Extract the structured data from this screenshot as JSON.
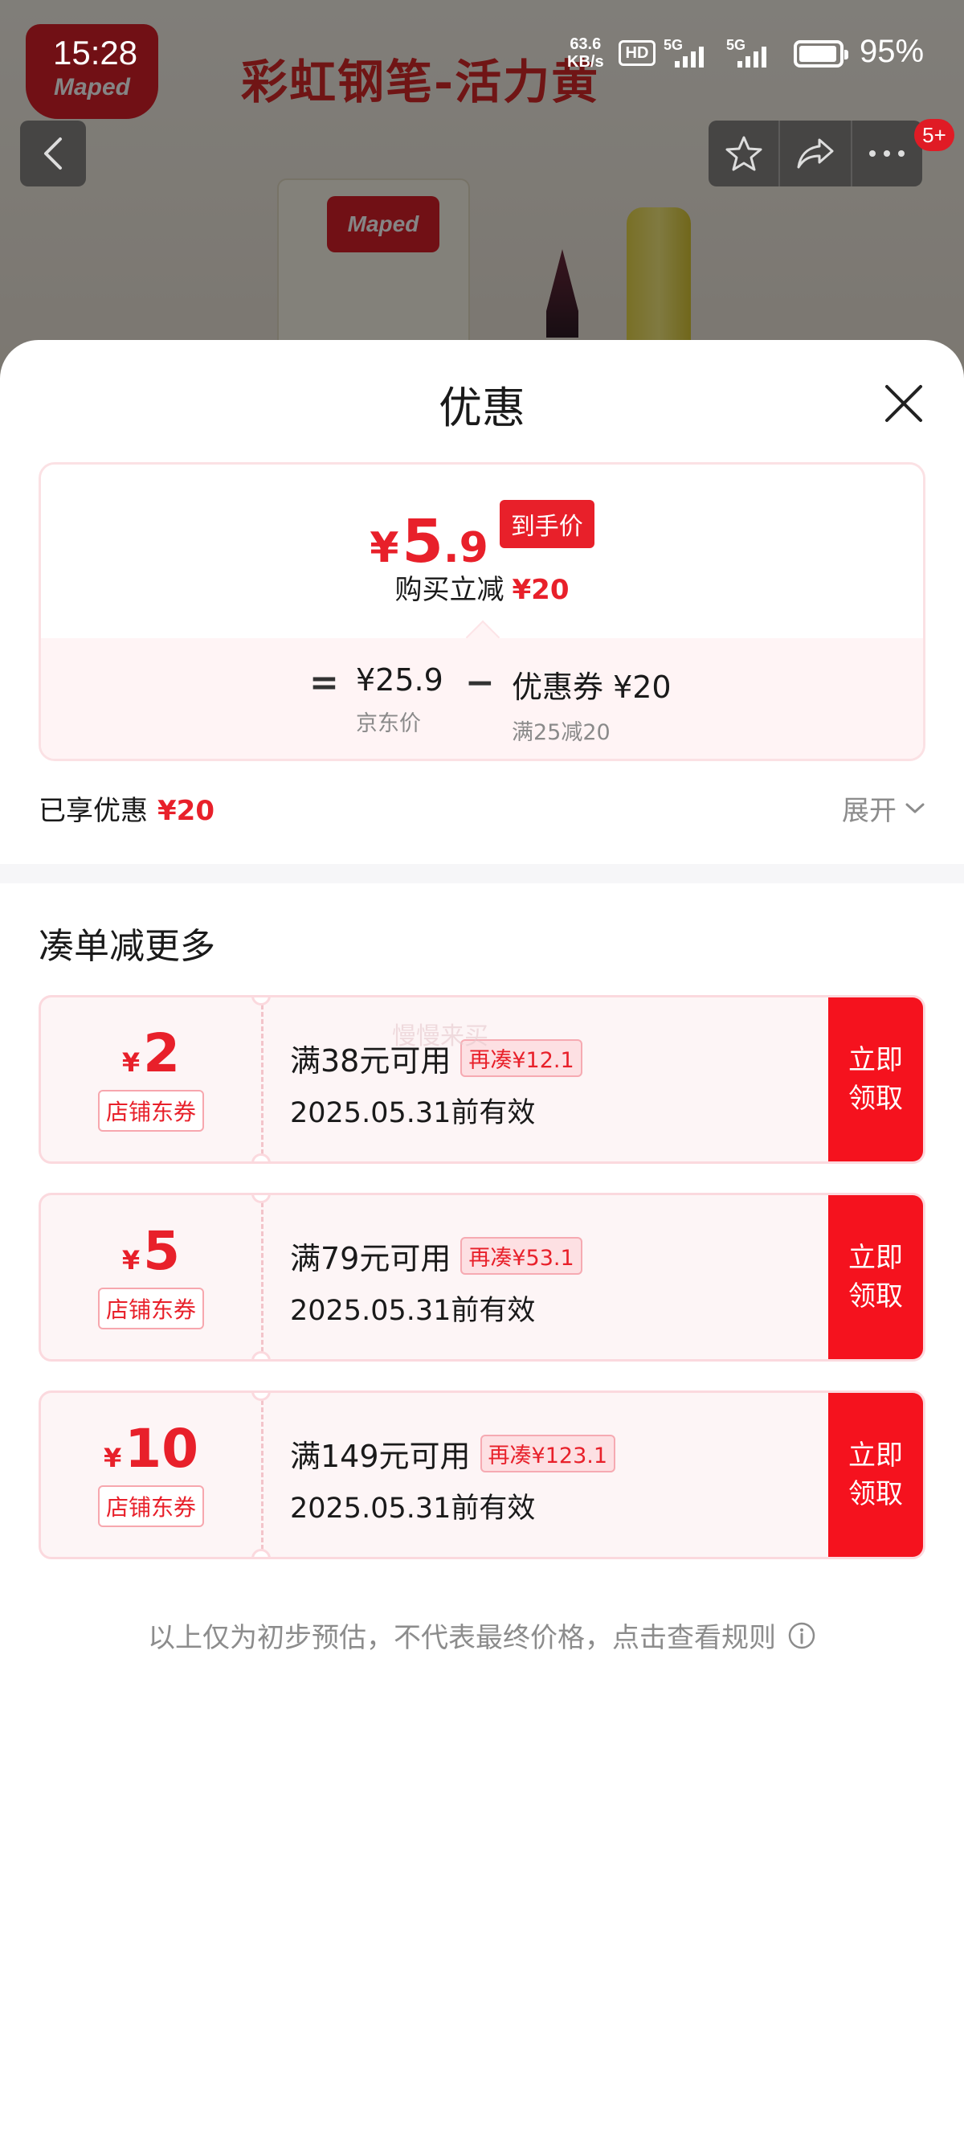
{
  "status_bar": {
    "time": "15:28",
    "net_speed_value": "63.6",
    "net_speed_unit": "KB/s",
    "hd_label": "HD",
    "signal_1_label": "5G",
    "signal_2_label": "5G",
    "battery_percent": "95%"
  },
  "background_page": {
    "brand_logo": "Maped",
    "title": "彩虹钢笔-活力黄",
    "box_logo": "Maped",
    "cart_badge": "5+"
  },
  "sheet": {
    "title": "优惠",
    "price_card": {
      "final_currency": "¥",
      "final_int": "5",
      "final_dec": ".9",
      "final_tag": "到手价",
      "reduce_label": "购买立减",
      "reduce_amount": "¥20",
      "eq_sign": "=",
      "minus_sign": "−",
      "jd_price": "¥25.9",
      "jd_price_label": "京东价",
      "coupon_value": "优惠券 ¥20",
      "coupon_rule": "满25减20"
    },
    "enjoyed": {
      "label": "已享优惠",
      "amount": "¥20",
      "expand_label": "展开"
    },
    "section_title": "凑单减更多",
    "watermark": "慢慢来买",
    "coupons": [
      {
        "currency": "¥",
        "amount": "2",
        "type": "店铺东券",
        "condition": "满38元可用",
        "tag": "再凑¥12.1",
        "validity": "2025.05.31前有效",
        "button": "立即\n领取"
      },
      {
        "currency": "¥",
        "amount": "5",
        "type": "店铺东券",
        "condition": "满79元可用",
        "tag": "再凑¥53.1",
        "validity": "2025.05.31前有效",
        "button": "立即\n领取"
      },
      {
        "currency": "¥",
        "amount": "10",
        "type": "店铺东券",
        "condition": "满149元可用",
        "tag": "再凑¥123.1",
        "validity": "2025.05.31前有效",
        "button": "立即\n领取"
      }
    ],
    "footer_note": "以上仅为初步预估，不代表最终价格，点击查看规则"
  },
  "colors": {
    "accent_red": "#e8202a",
    "button_red": "#f5121e",
    "coupon_bg": "#fdf5f6",
    "muted_text": "#8c8c8c"
  },
  "icons": [
    "back-arrow-icon",
    "star-icon",
    "share-icon",
    "more-icon",
    "close-icon",
    "chevron-down-icon",
    "info-icon"
  ]
}
